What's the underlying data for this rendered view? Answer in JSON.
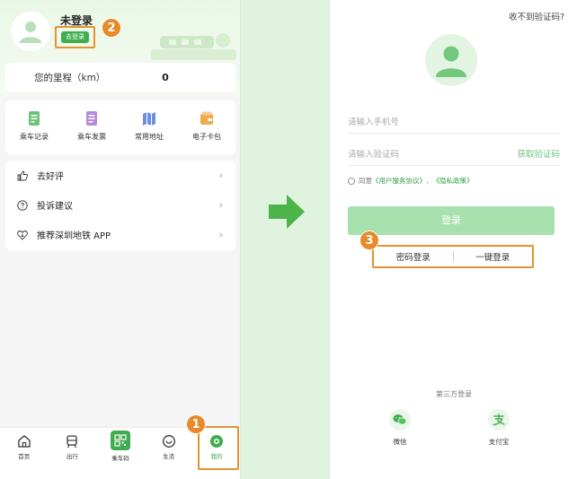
{
  "left": {
    "user": {
      "name": "未登录",
      "login_badge": "去登录"
    },
    "mileage": {
      "label": "您的里程（km）",
      "value": "0"
    },
    "quick_actions": [
      {
        "label": "乘车记录",
        "icon": "receipt-icon"
      },
      {
        "label": "乘车发票",
        "icon": "invoice-icon"
      },
      {
        "label": "常用地址",
        "icon": "map-icon"
      },
      {
        "label": "电子卡包",
        "icon": "wallet-icon"
      }
    ],
    "menu": [
      {
        "label": "去好评",
        "icon": "thumbs-up-icon"
      },
      {
        "label": "投诉建议",
        "icon": "question-icon"
      },
      {
        "label": "推荐深圳地铁 APP",
        "icon": "heart-download-icon"
      }
    ],
    "tabs": [
      {
        "label": "首页",
        "icon": "home-icon"
      },
      {
        "label": "出行",
        "icon": "train-icon"
      },
      {
        "label": "乘车码",
        "icon": "qr-code-icon"
      },
      {
        "label": "生活",
        "icon": "life-icon"
      },
      {
        "label": "我的",
        "icon": "profile-icon"
      }
    ]
  },
  "annotations": {
    "step1": "1",
    "step2": "2",
    "step3": "3"
  },
  "right": {
    "no_code_link": "收不到验证码?",
    "phone_placeholder": "请输入手机号",
    "code_placeholder": "请输入验证码",
    "get_code": "获取验证码",
    "agree_prefix": "同意",
    "agree_terms": "《用户服务协议》",
    "agree_sep": "、",
    "agree_privacy": "《隐私政策》",
    "login_button": "登录",
    "password_login": "密码登录",
    "one_click_login": "一键登录",
    "third_party": "第三方登录",
    "social": [
      {
        "label": "微信",
        "icon": "wechat-icon"
      },
      {
        "label": "支付宝",
        "icon": "alipay-icon"
      }
    ]
  },
  "colors": {
    "brand_green": "#3fad4d",
    "highlight_orange": "#e3922e",
    "arrow_green": "#4cb54a"
  }
}
